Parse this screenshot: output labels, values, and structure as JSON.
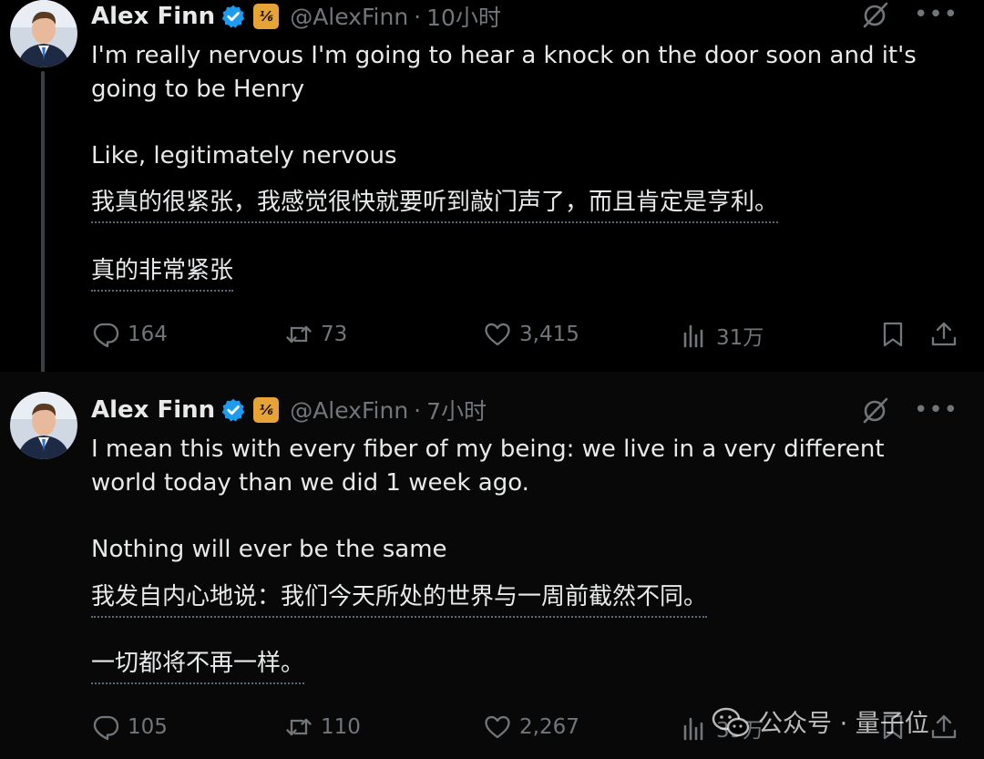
{
  "tweets": [
    {
      "author": {
        "name": "Alex Finn",
        "handle": "@AlexFinn",
        "separator": "·",
        "time": "10小时"
      },
      "text_en": [
        "I'm really nervous I'm going to hear a knock on the door soon and it's going to be Henry",
        "Like, legitimately nervous"
      ],
      "text_zh": [
        "我真的很紧张，我感觉很快就要听到敲门声了，而且肯定是亨利。",
        "真的非常紧张"
      ],
      "stats": {
        "replies": "164",
        "reposts": "73",
        "likes": "3,415",
        "views": "31万"
      }
    },
    {
      "author": {
        "name": "Alex Finn",
        "handle": "@AlexFinn",
        "separator": "·",
        "time": "7小时"
      },
      "text_en": [
        "I mean this with every fiber of my being: we live in a very different world today than we did 1 week ago.",
        "Nothing will ever be the same"
      ],
      "text_zh": [
        "我发自内心地说：我们今天所处的世界与一周前截然不同。",
        "一切都将不再一样。"
      ],
      "stats": {
        "replies": "105",
        "reposts": "110",
        "likes": "2,267",
        "views": "39万"
      }
    }
  ],
  "affiliate_badge": "⅙",
  "watermark": {
    "text": "公众号 · 量子位"
  },
  "colors": {
    "background": "#000000",
    "text": "#e7e9ea",
    "muted": "#71767b",
    "verified": "#1d9bf0",
    "affiliate_badge": "#e8a336"
  },
  "icons": [
    "reply-icon",
    "repost-icon",
    "like-icon",
    "views-icon",
    "bookmark-icon",
    "share-icon",
    "grok-icon",
    "more-icon",
    "verified-icon",
    "wechat-icon"
  ]
}
